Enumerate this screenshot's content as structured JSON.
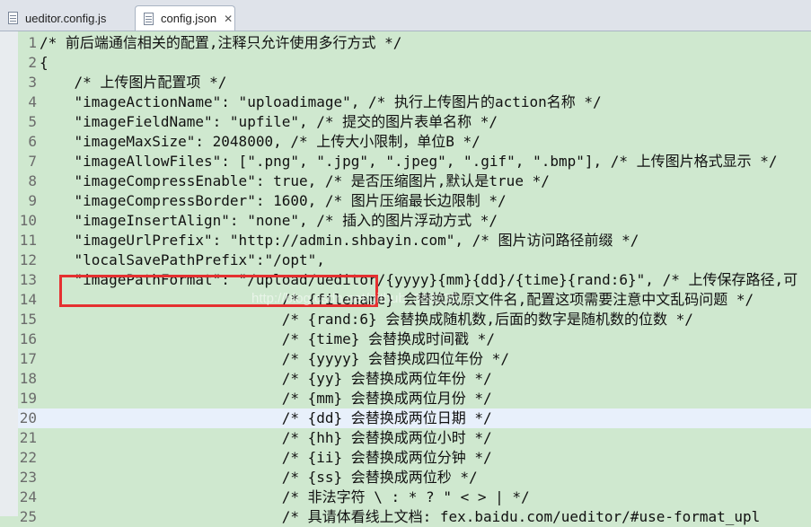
{
  "tabs": [
    {
      "label": "ueditor.config.js",
      "close": ""
    },
    {
      "label": "config.json",
      "close": "✕"
    }
  ],
  "watermark": "http://blog.csdn.net/github_38823514",
  "lines": [
    {
      "n": "1",
      "t": "/* 前后端通信相关的配置,注释只允许使用多行方式 */"
    },
    {
      "n": "2",
      "t": "{"
    },
    {
      "n": "3",
      "t": "    /* 上传图片配置项 */"
    },
    {
      "n": "4",
      "t": "    \"imageActionName\": \"uploadimage\", /* 执行上传图片的action名称 */"
    },
    {
      "n": "5",
      "t": "    \"imageFieldName\": \"upfile\", /* 提交的图片表单名称 */"
    },
    {
      "n": "6",
      "t": "    \"imageMaxSize\": 2048000, /* 上传大小限制，单位B */"
    },
    {
      "n": "7",
      "t": "    \"imageAllowFiles\": [\".png\", \".jpg\", \".jpeg\", \".gif\", \".bmp\"], /* 上传图片格式显示 */"
    },
    {
      "n": "8",
      "t": "    \"imageCompressEnable\": true, /* 是否压缩图片,默认是true */"
    },
    {
      "n": "9",
      "t": "    \"imageCompressBorder\": 1600, /* 图片压缩最长边限制 */"
    },
    {
      "n": "10",
      "t": "    \"imageInsertAlign\": \"none\", /* 插入的图片浮动方式 */"
    },
    {
      "n": "11",
      "t": "    \"imageUrlPrefix\": \"http://admin.shbayin.com\", /* 图片访问路径前缀 */"
    },
    {
      "n": "12",
      "t": "    \"localSavePathPrefix\":\"/opt\","
    },
    {
      "n": "13",
      "t": "    \"imagePathFormat\": \"/upload/ueditor/{yyyy}{mm}{dd}/{time}{rand:6}\", /* 上传保存路径,可"
    },
    {
      "n": "14",
      "t": "                            /* {filename} 会替换成原文件名,配置这项需要注意中文乱码问题 */"
    },
    {
      "n": "15",
      "t": "                            /* {rand:6} 会替换成随机数,后面的数字是随机数的位数 */"
    },
    {
      "n": "16",
      "t": "                            /* {time} 会替换成时间戳 */"
    },
    {
      "n": "17",
      "t": "                            /* {yyyy} 会替换成四位年份 */"
    },
    {
      "n": "18",
      "t": "                            /* {yy} 会替换成两位年份 */"
    },
    {
      "n": "19",
      "t": "                            /* {mm} 会替换成两位月份 */"
    },
    {
      "n": "20",
      "t": "                            /* {dd} 会替换成两位日期 */"
    },
    {
      "n": "21",
      "t": "                            /* {hh} 会替换成两位小时 */"
    },
    {
      "n": "22",
      "t": "                            /* {ii} 会替换成两位分钟 */"
    },
    {
      "n": "23",
      "t": "                            /* {ss} 会替换成两位秒 */"
    },
    {
      "n": "24",
      "t": "                            /* 非法字符 \\ : * ? \" < > | */"
    },
    {
      "n": "25",
      "t": "                            /* 具请体看线上文档: fex.baidu.com/ueditor/#use-format_upl"
    }
  ]
}
